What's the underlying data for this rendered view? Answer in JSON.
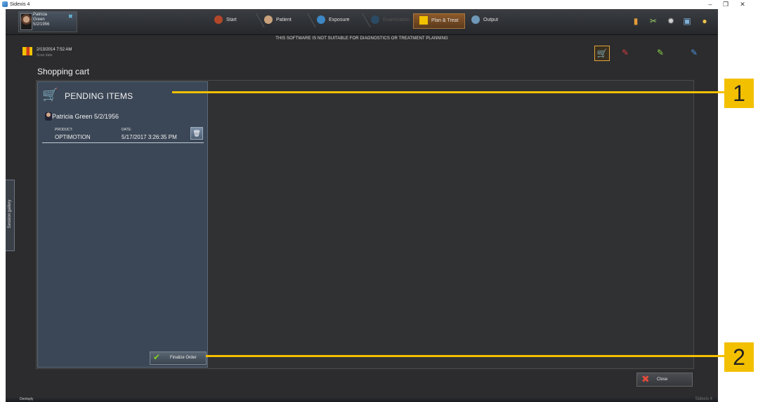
{
  "window": {
    "title": "Sidexis 4",
    "minimize": "–",
    "maximize": "❐",
    "close": "✕"
  },
  "patient": {
    "first": "Patricia",
    "last": "Green",
    "dob": "5/2/1956"
  },
  "workflow": [
    {
      "label": "Start"
    },
    {
      "label": "Patient"
    },
    {
      "label": "Exposure"
    },
    {
      "label": "Examination"
    },
    {
      "label": "Plan & Treat"
    },
    {
      "label": "Output"
    }
  ],
  "notice": "THIS SOFTWARE IS NOT SUITABLE FOR DIAGNOSTICS OR TREATMENT PLANNING",
  "scan": {
    "date": "2/13/2014 7:52 AM",
    "label": "Scan date"
  },
  "page_title": "Shopping cart",
  "cart": {
    "heading": "PENDING ITEMS",
    "items": [
      {
        "patient": "Patricia Green 5/2/1956",
        "product_label": "PRODUCT:",
        "product": "OPTIMOTION",
        "date_label": "DATE:",
        "date": "5/17/2017 3:26:35 PM"
      }
    ],
    "finalize_label": "Finalize Order"
  },
  "close_label": "Close",
  "session_gallery": "Session gallery",
  "footer": {
    "brand": "Dentsply",
    "product": "Sidexis 4"
  },
  "callouts": [
    "1",
    "2"
  ],
  "colors": {
    "accent": "#f3c000",
    "panel": "#3b4756",
    "background": "#2c2c2e"
  }
}
